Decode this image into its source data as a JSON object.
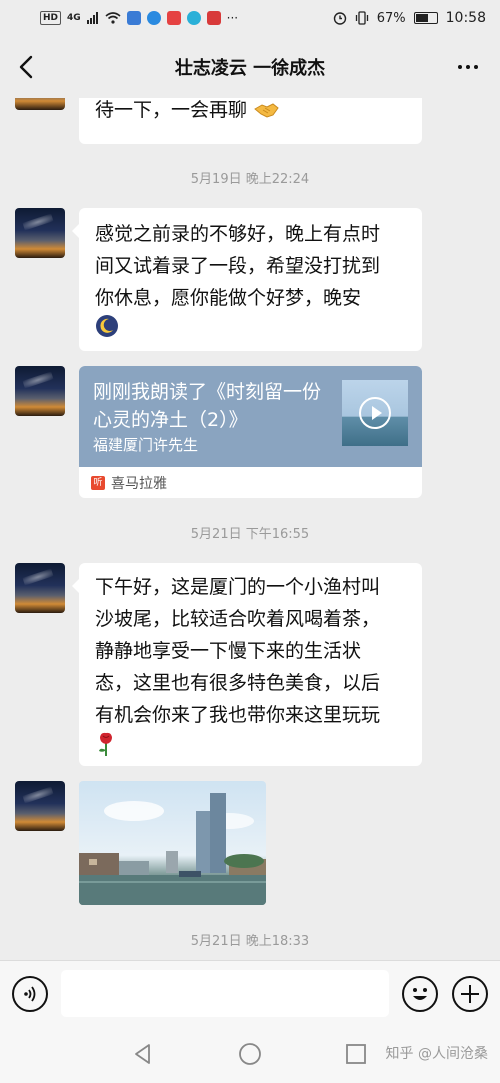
{
  "status_bar": {
    "network": "HD",
    "signal": "4G",
    "battery_percent": "67%",
    "battery_level": 0.67,
    "time": "10:58"
  },
  "header": {
    "title": "壮志凌云 一徐成杰"
  },
  "messages": [
    {
      "type": "text",
      "text": "待一下，一会再聊"
    },
    {
      "type": "time",
      "text": "5月19日 晚上22:24"
    },
    {
      "type": "text",
      "lines": [
        "感觉之前录的不够好，晚上有点时",
        "间又试着录了一段，希望没打扰到",
        "你休息，愿你能做个好梦，晚安"
      ]
    },
    {
      "type": "share",
      "title": "刚刚我朗读了《时刻留一份心灵的净土（2）》",
      "author": "福建厦门许先生",
      "source": "喜马拉雅",
      "source_icon_text": "听"
    },
    {
      "type": "time",
      "text": "5月21日 下午16:55"
    },
    {
      "type": "text",
      "lines": [
        "下午好，这是厦门的一个小渔村叫",
        "沙坡尾，比较适合吹着风喝着茶，",
        "静静地享受一下慢下来的生活状",
        "态，这里也有很多特色美食，以后",
        "有机会你来了我也带你来这里玩玩"
      ]
    },
    {
      "type": "image",
      "description": "photo"
    },
    {
      "type": "time",
      "text": "5月21日 晚上18:33"
    }
  ],
  "input": {
    "placeholder": ""
  },
  "watermark": "知乎 @人间沧桑",
  "colors": {
    "background": "#ededed",
    "bubble": "#ffffff",
    "share_card": "#8aa4c0",
    "timestamp": "#9a9a9a"
  }
}
